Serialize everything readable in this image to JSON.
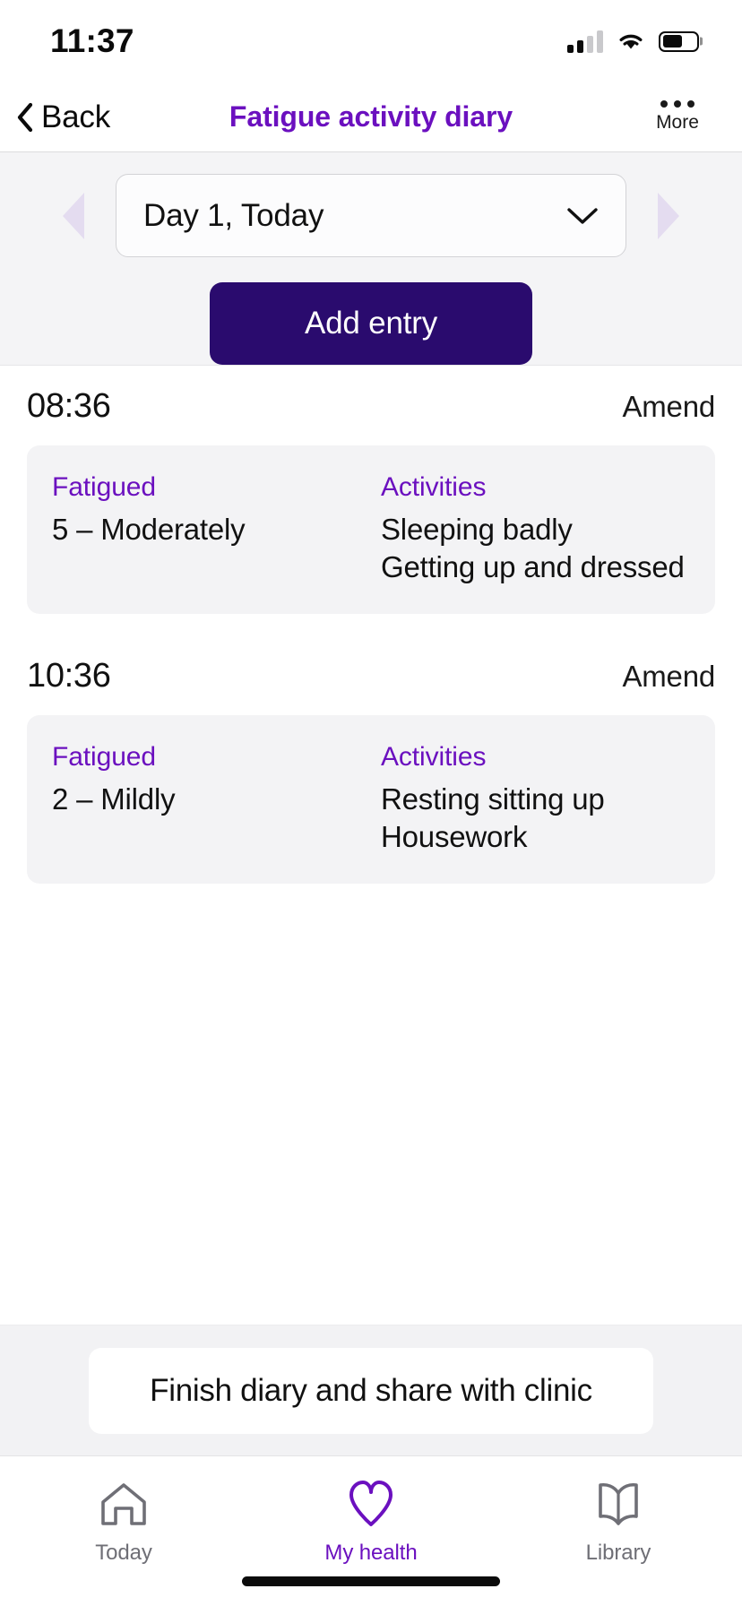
{
  "status_bar": {
    "time": "11:37",
    "signal_icon": "cellular-signal-icon",
    "wifi_icon": "wifi-icon",
    "battery_icon": "battery-icon",
    "battery_level_pct": 60
  },
  "nav": {
    "back_label": "Back",
    "back_icon": "chevron-left-icon",
    "title": "Fatigue activity diary",
    "more_label": "More",
    "more_icon": "ellipsis-icon"
  },
  "day_selector": {
    "prev_icon": "triangle-left-icon",
    "next_icon": "triangle-right-icon",
    "selected_day": "Day 1, Today",
    "dropdown_icon": "chevron-down-icon",
    "add_entry_label": "Add entry"
  },
  "entries": [
    {
      "time": "08:36",
      "amend_label": "Amend",
      "fatigue_title": "Fatigued",
      "fatigue_value": "5 – Moderately",
      "activities_title": "Activities",
      "activities": [
        "Sleeping badly",
        "Getting up and dressed"
      ]
    },
    {
      "time": "10:36",
      "amend_label": "Amend",
      "fatigue_title": "Fatigued",
      "fatigue_value": "2 – Mildly",
      "activities_title": "Activities",
      "activities": [
        "Resting sitting up",
        "Housework"
      ]
    }
  ],
  "footer": {
    "finish_label": "Finish diary and share with clinic"
  },
  "tabbar": {
    "tabs": [
      {
        "label": "Today",
        "icon": "home-icon",
        "active": false
      },
      {
        "label": "My health",
        "icon": "heart-icon",
        "active": true
      },
      {
        "label": "Library",
        "icon": "book-icon",
        "active": false
      }
    ]
  },
  "colors": {
    "brand_purple": "#6b10bf",
    "deep_indigo": "#2a0b6e",
    "card_grey": "#f3f3f5",
    "band_grey": "#f4f4f6",
    "arrow_lilac": "#e4dcf0",
    "inactive_grey": "#6f6f76"
  }
}
